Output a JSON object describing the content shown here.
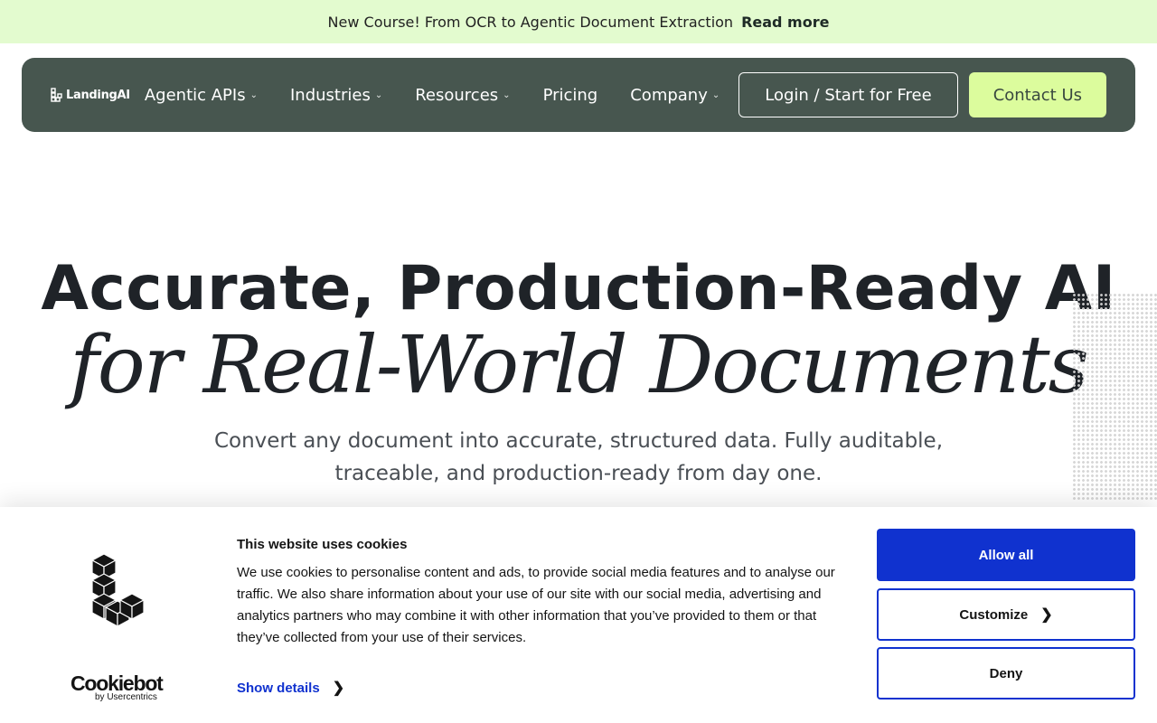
{
  "banner": {
    "text": "New Course! From OCR to Agentic Document Extraction",
    "link": "Read more"
  },
  "nav": {
    "logo_text": "LandingAI",
    "items": [
      {
        "label": "Agentic APIs",
        "has_dropdown": true
      },
      {
        "label": "Industries",
        "has_dropdown": true
      },
      {
        "label": "Resources",
        "has_dropdown": true
      },
      {
        "label": "Pricing",
        "has_dropdown": false
      },
      {
        "label": "Company",
        "has_dropdown": true
      }
    ],
    "login_label": "Login / Start for Free",
    "contact_label": "Contact Us"
  },
  "hero": {
    "title_line1": "Accurate, Production-Ready AI",
    "title_line2": "for Real-World Documents",
    "subtitle": "Convert any document into accurate, structured data. Fully auditable, traceable, and production-ready from day one."
  },
  "cookie_banner": {
    "title": "This website uses cookies",
    "body": "We use cookies to personalise content and ads, to provide social media features and to analyse our traffic. We also share information about your use of our site with our social media, advertising and analytics partners who may combine it with other information that you’ve provided to them or that they’ve collected from your use of their services.",
    "show_details": "Show details",
    "allow_all": "Allow all",
    "customize": "Customize",
    "deny": "Deny",
    "brand_name": "Cookiebot",
    "brand_by": "by Usercentrics"
  },
  "colors": {
    "banner_bg": "#e3fbcf",
    "nav_bg": "#47564f",
    "contact_bg": "#dcfc9d",
    "cookie_accent": "#1032cf"
  },
  "icons": [
    "landingai-logo-icon",
    "chevron-down-icon",
    "chevron-right-icon",
    "block-logo-icon"
  ]
}
